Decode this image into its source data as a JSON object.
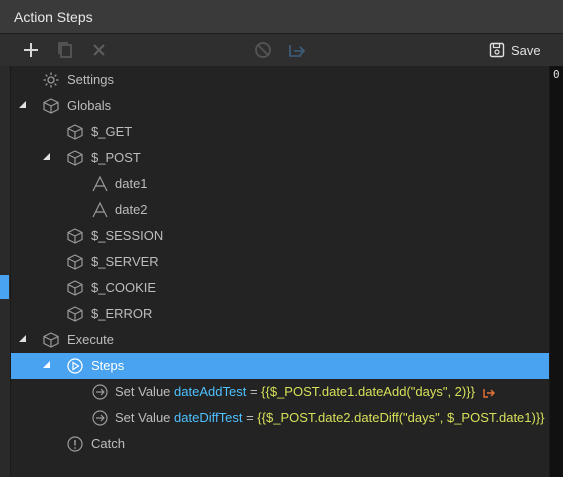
{
  "window": {
    "title": "Action Steps"
  },
  "toolbar": {
    "add_icon": "plus-icon",
    "copy_icon": "copy-icon",
    "delete_icon": "close-icon",
    "disable_icon": "block-icon",
    "move_icon": "export-icon",
    "save_label": "Save"
  },
  "tree": {
    "settings": "Settings",
    "globals": "Globals",
    "get": "$_GET",
    "post": "$_POST",
    "date1": "date1",
    "date2": "date2",
    "session": "$_SESSION",
    "server": "$_SERVER",
    "cookie": "$_COOKIE",
    "error": "$_ERROR",
    "execute": "Execute",
    "steps": "Steps",
    "step1": {
      "prefix": "Set Value",
      "key": "dateAddTest",
      "eq": " = ",
      "value": "{{$_POST.date1.dateAdd(\"days\", 2)}}"
    },
    "step2": {
      "prefix": "Set Value",
      "key": "dateDiffTest",
      "eq": " = ",
      "value": "{{$_POST.date2.dateDiff(\"days\", $_POST.date1)}}"
    },
    "catch": "Catch"
  },
  "side": {
    "right_digit": "0"
  },
  "colors": {
    "accent": "#4aa3f0",
    "variable": "#4fc1ff",
    "expression": "#d7e05a",
    "link_arrow": "#e8733a"
  }
}
